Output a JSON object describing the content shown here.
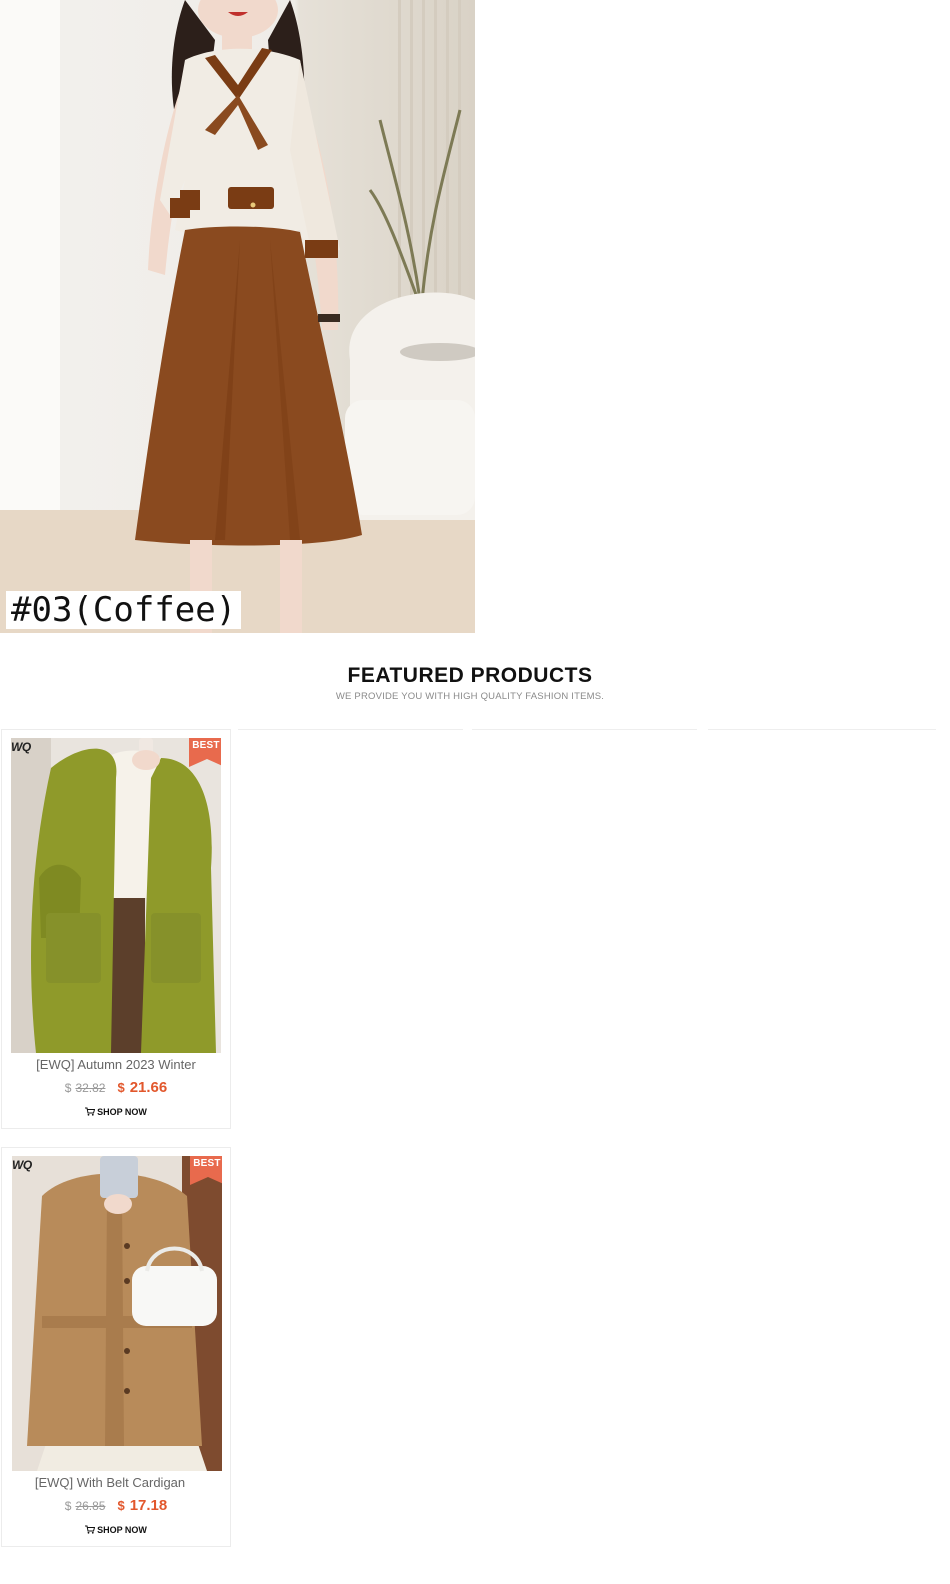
{
  "hero": {
    "variant_label": "#03(Coffee)",
    "colors": {
      "skirt": "#8a4a1f",
      "blouse": "#f1ece4",
      "trim": "#7a3c14"
    }
  },
  "section": {
    "title": "FEATURED PRODUCTS",
    "subtitle": "WE PROVIDE YOU WITH HIGH QUALITY FASHION ITEMS."
  },
  "products": [
    {
      "brand": "WQ",
      "badge": "BEST",
      "name": "[EWQ] Autumn 2023 Winter",
      "currency": "$",
      "old_price": "32.82",
      "new_price": "21.66",
      "cta": "SHOP NOW",
      "image_color": "#8f9a2a"
    },
    {
      "brand": "WQ",
      "badge": "BEST",
      "name": "[EWQ] With Belt Cardigan",
      "currency": "$",
      "old_price": "26.85",
      "new_price": "17.18",
      "cta": "SHOP NOW",
      "image_color": "#b88b5a"
    }
  ],
  "accent_color": "#e2572c",
  "badge_color": "#e86a4d"
}
